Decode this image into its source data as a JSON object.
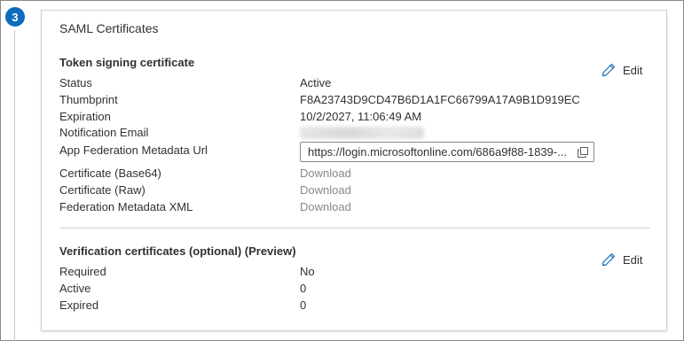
{
  "step": {
    "number": "3"
  },
  "card": {
    "title": "SAML Certificates"
  },
  "token_section": {
    "title": "Token signing certificate",
    "edit_label": "Edit",
    "rows": {
      "status": {
        "label": "Status",
        "value": "Active"
      },
      "thumbprint": {
        "label": "Thumbprint",
        "value": "F8A23743D9CD47B6D1A1FC66799A17A9B1D919EC"
      },
      "expiration": {
        "label": "Expiration",
        "value": "10/2/2027, 11:06:49 AM"
      },
      "notification_email": {
        "label": "Notification Email"
      },
      "metadata_url": {
        "label": "App Federation Metadata Url",
        "value": "https://login.microsoftonline.com/686a9f88-1839-..."
      },
      "cert_base64": {
        "label": "Certificate (Base64)",
        "value": "Download"
      },
      "cert_raw": {
        "label": "Certificate (Raw)",
        "value": "Download"
      },
      "federation_xml": {
        "label": "Federation Metadata XML",
        "value": "Download"
      }
    }
  },
  "verification_section": {
    "title": "Verification certificates (optional) (Preview)",
    "edit_label": "Edit",
    "rows": {
      "required": {
        "label": "Required",
        "value": "No"
      },
      "active": {
        "label": "Active",
        "value": "0"
      },
      "expired": {
        "label": "Expired",
        "value": "0"
      }
    }
  },
  "colors": {
    "accent": "#0f6cbd",
    "link_disabled": "#8a8886",
    "text": "#323130"
  },
  "icons": {
    "edit": "pencil-icon",
    "copy": "copy-icon"
  }
}
